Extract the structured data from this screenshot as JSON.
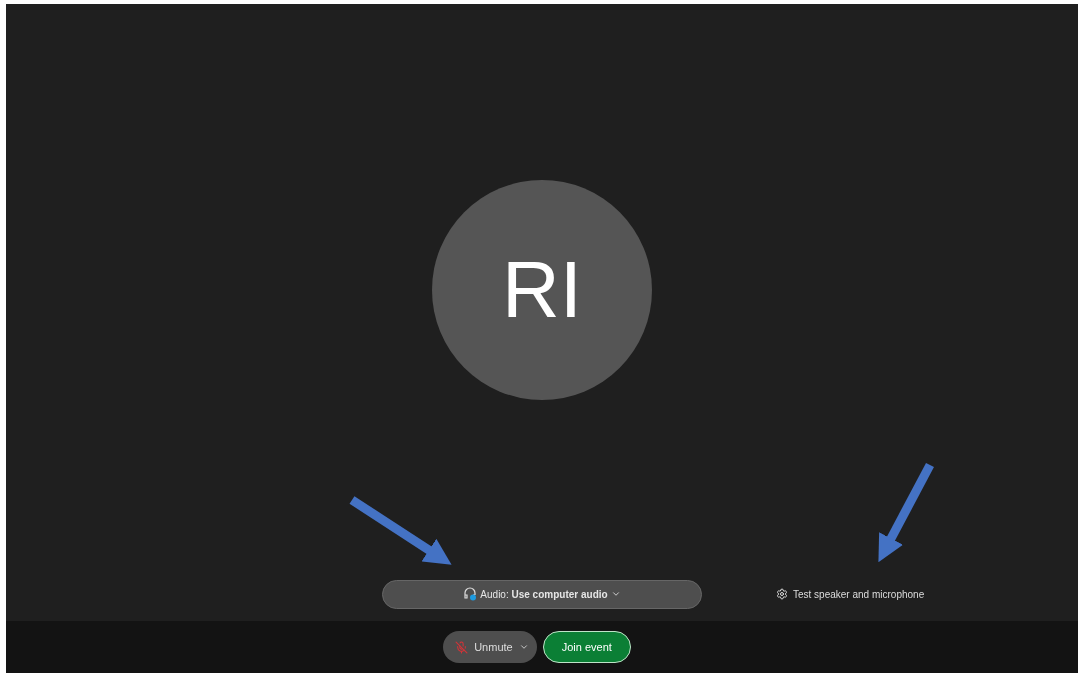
{
  "avatar": {
    "initials": "RI"
  },
  "audio": {
    "text": "Audio: **Use computer audio**"
  },
  "test_button": {
    "label": "Test speaker and microphone"
  },
  "mic_button": {
    "label": "Unmute",
    "muted": true
  },
  "join_button": {
    "label": "Join event"
  }
}
